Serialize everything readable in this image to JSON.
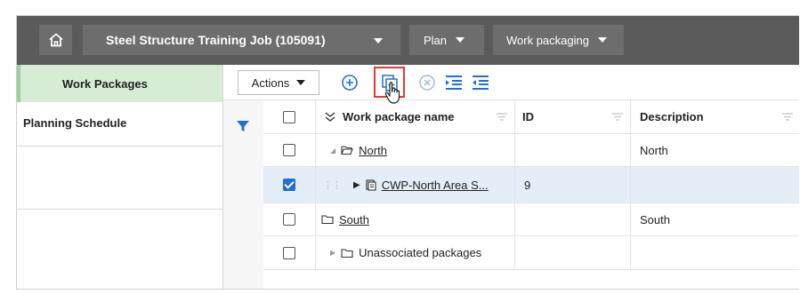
{
  "topbar": {
    "job_title": "Steel Structure Training Job (105091)",
    "plan_label": "Plan",
    "section_label": "Work packaging"
  },
  "sidebar": {
    "items": [
      {
        "label": "Work Packages",
        "active": true
      },
      {
        "label": "Planning Schedule",
        "active": false
      }
    ]
  },
  "toolbar": {
    "actions_label": "Actions",
    "icons": [
      "add-circle-icon",
      "add-copy-icon",
      "remove-circle-icon",
      "indent-icon",
      "outdent-icon"
    ],
    "highlight_color": "#e53935"
  },
  "grid": {
    "columns": [
      "Work package name",
      "ID",
      "Description"
    ],
    "rows": [
      {
        "name": "North",
        "id": "",
        "description": "North",
        "checked": false
      },
      {
        "name": "CWP-North Area S...",
        "id": "9",
        "description": "",
        "checked": true
      },
      {
        "name": "South",
        "id": "",
        "description": "South",
        "checked": false
      },
      {
        "name": "Unassociated packages",
        "id": "",
        "description": "",
        "checked": false
      }
    ]
  },
  "colors": {
    "topbar_bg": "#5b5b5b",
    "active_nav_bg": "#d6ecd5",
    "accent_blue": "#1e6fd9",
    "selected_row_bg": "#e4eef9"
  }
}
